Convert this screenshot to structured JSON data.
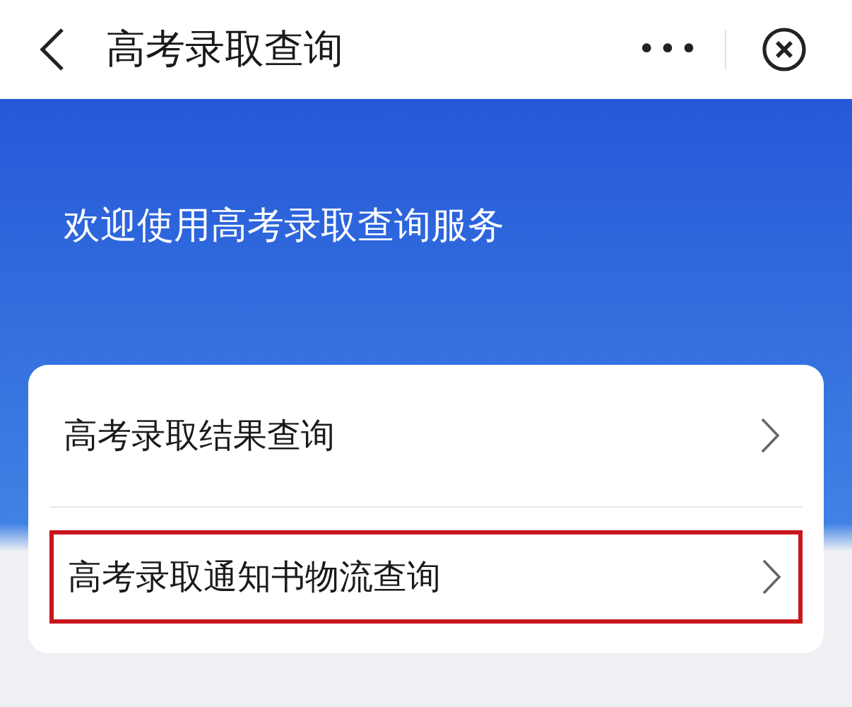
{
  "top_bar": {
    "title": "高考录取查询",
    "more": "•••"
  },
  "welcome": "欢迎使用高考录取查询服务",
  "menu": [
    {
      "label": "高考录取结果查询",
      "highlighted": false
    },
    {
      "label": "高考录取通知书物流查询",
      "highlighted": true
    }
  ]
}
